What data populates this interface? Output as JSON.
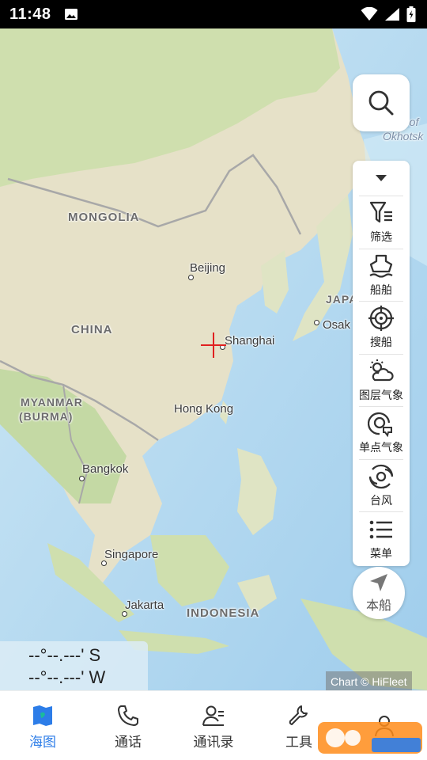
{
  "status_bar": {
    "time": "11:48"
  },
  "map": {
    "labels": {
      "mongolia": "MONGOLIA",
      "china": "CHINA",
      "beijing": "Beijing",
      "shanghai": "Shanghai",
      "hong_kong": "Hong Kong",
      "myanmar": "MYANMAR",
      "burma": "(BURMA)",
      "bangkok": "Bangkok",
      "singapore": "Singapore",
      "jakarta": "Jakarta",
      "indonesia": "INDONESIA",
      "japan": "JAPA",
      "osaka": "Osak",
      "sea_of": "a of",
      "okhotsk": "Okhotsk"
    },
    "colors": {
      "land": "#e8e4cf",
      "land_green": "#cfe0b0",
      "water": "#bfe0f2",
      "deep_water": "#9ccbea",
      "crosshair": "#e02020"
    }
  },
  "toolbar": {
    "search_icon": "search-icon",
    "collapse_icon": "caret-down-icon",
    "items": [
      {
        "label": "筛选",
        "icon": "filter-icon"
      },
      {
        "label": "船舶",
        "icon": "ship-icon"
      },
      {
        "label": "搜船",
        "icon": "target-icon"
      },
      {
        "label": "图层气象",
        "icon": "weather-layer-icon"
      },
      {
        "label": "单点气象",
        "icon": "point-weather-icon"
      },
      {
        "label": "台风",
        "icon": "typhoon-icon"
      },
      {
        "label": "菜单",
        "icon": "menu-list-icon"
      }
    ]
  },
  "own_ship": {
    "label": "本船",
    "icon": "navigation-arrow-icon"
  },
  "coordinates": {
    "lat": "--°--.---' S",
    "lon": "--°--.---' W"
  },
  "attribution": "Chart © HiFleet",
  "bottom_nav": {
    "active_color": "#2d7de8",
    "items": [
      {
        "label": "海图",
        "icon": "chart-map-icon",
        "active": true
      },
      {
        "label": "通话",
        "icon": "phone-icon",
        "active": false
      },
      {
        "label": "通讯录",
        "icon": "contacts-icon",
        "active": false
      },
      {
        "label": "工具",
        "icon": "wrench-icon",
        "active": false
      },
      {
        "label": "",
        "icon": "profile-icon",
        "active": false
      }
    ]
  }
}
